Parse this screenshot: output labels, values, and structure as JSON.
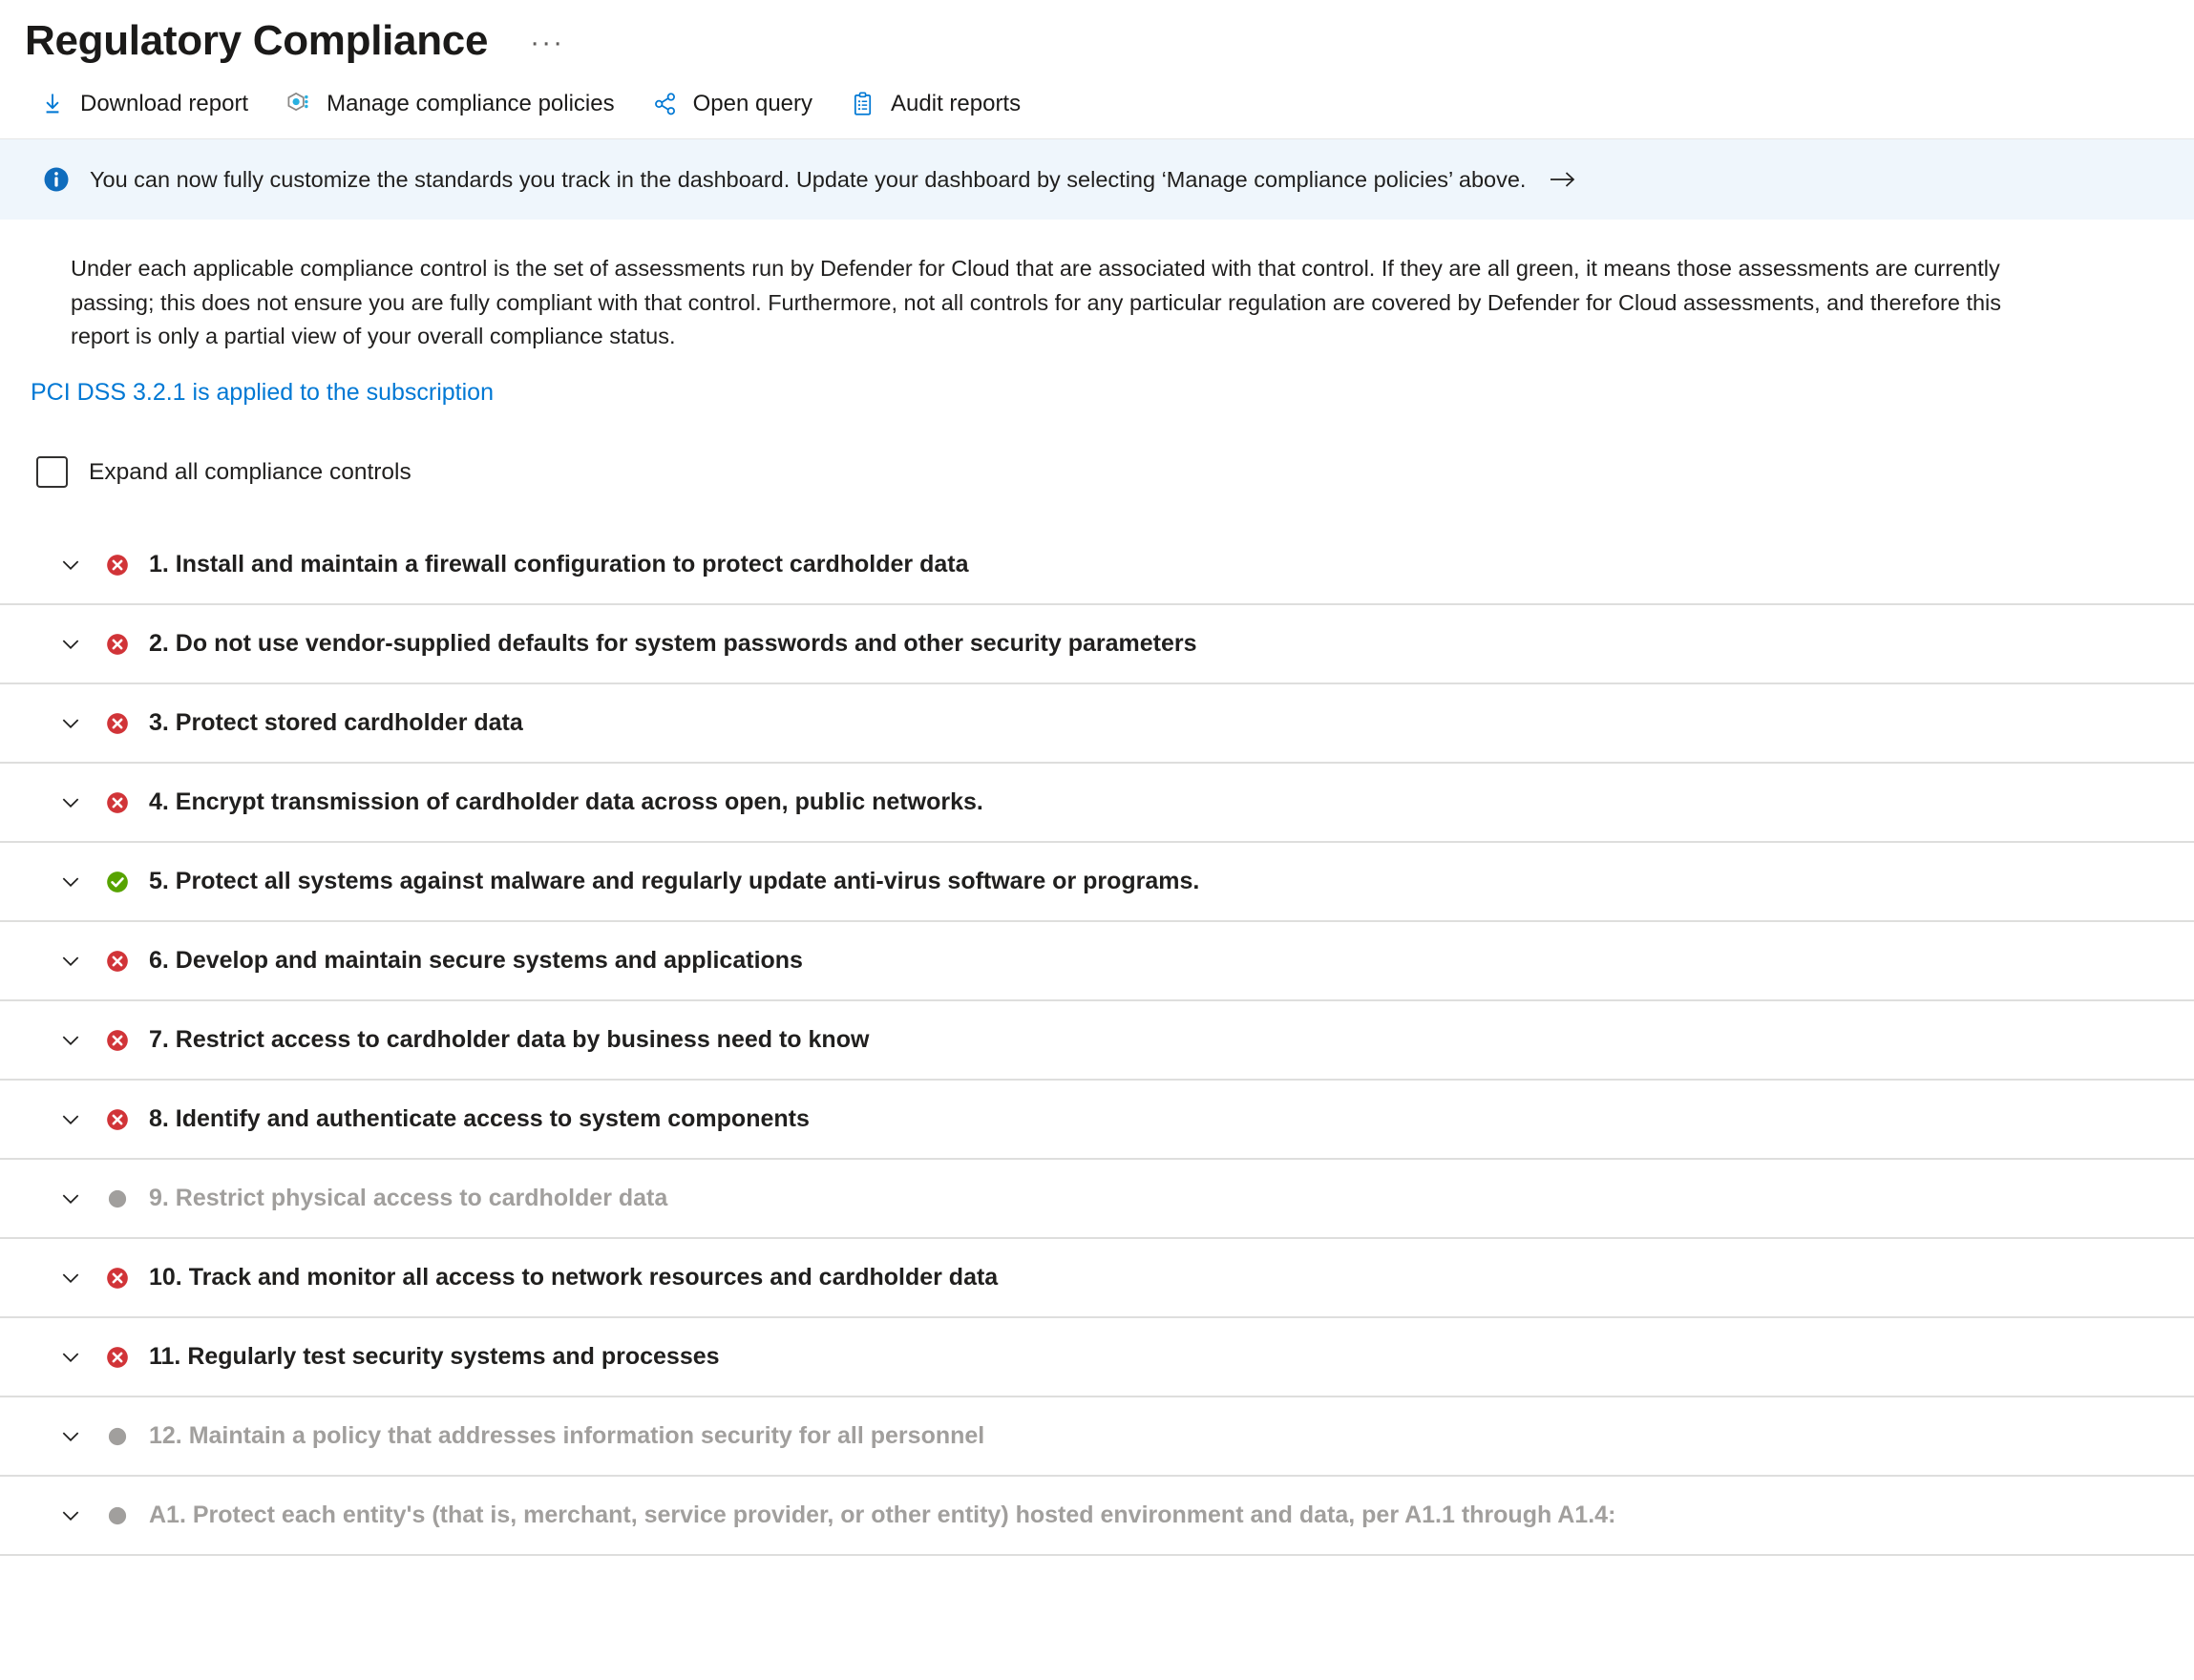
{
  "header": {
    "title": "Regulatory Compliance",
    "ellipsis": "···"
  },
  "toolbar": {
    "items": [
      {
        "label": "Download report",
        "icon": "download-icon"
      },
      {
        "label": "Manage compliance policies",
        "icon": "policy-hexagon-icon"
      },
      {
        "label": "Open query",
        "icon": "share-graph-icon"
      },
      {
        "label": "Audit reports",
        "icon": "clipboard-list-icon"
      }
    ]
  },
  "banner": {
    "icon": "info-circle-icon",
    "text": "You can now fully customize the standards you track in the dashboard. Update your dashboard by selecting ‘Manage compliance policies’ above.",
    "arrow_icon": "arrow-right-icon"
  },
  "description": {
    "text": "Under each applicable compliance control is the set of assessments run by Defender for Cloud that are associated with that control. If they are all green, it means those assessments are currently passing; this does not ensure you are fully compliant with that control. Furthermore, not all controls for any particular regulation are covered by Defender for Cloud assessments, and therefore this report is only a partial view of your overall compliance status."
  },
  "subscription": {
    "link_text": "PCI DSS 3.2.1 is applied to the subscription"
  },
  "expand_all": {
    "label": "Expand all compliance controls",
    "checked": false
  },
  "colors": {
    "accent": "#0078d4",
    "failed": "#d13438",
    "passed": "#57a300",
    "not_assessed": "#a19f9d",
    "banner_bg": "#eff6fc",
    "divider": "#dededd"
  },
  "controls": [
    {
      "label": "1. Install and maintain a firewall configuration to protect cardholder data",
      "status": "failed"
    },
    {
      "label": "2. Do not use vendor-supplied defaults for system passwords and other security parameters",
      "status": "failed"
    },
    {
      "label": "3. Protect stored cardholder data",
      "status": "failed"
    },
    {
      "label": "4. Encrypt transmission of cardholder data across open, public networks.",
      "status": "failed"
    },
    {
      "label": "5. Protect all systems against malware and regularly update anti-virus software or programs.",
      "status": "passed"
    },
    {
      "label": "6. Develop and maintain secure systems and applications",
      "status": "failed"
    },
    {
      "label": "7. Restrict access to cardholder data by business need to know",
      "status": "failed"
    },
    {
      "label": "8. Identify and authenticate access to system components",
      "status": "failed"
    },
    {
      "label": "9. Restrict physical access to cardholder data",
      "status": "not_assessed"
    },
    {
      "label": "10. Track and monitor all access to network resources and cardholder data",
      "status": "failed"
    },
    {
      "label": "11. Regularly test security systems and processes",
      "status": "failed"
    },
    {
      "label": "12. Maintain a policy that addresses information security for all personnel",
      "status": "not_assessed"
    },
    {
      "label": "A1. Protect each entity's (that is, merchant, service provider, or other entity) hosted environment and data, per A1.1 through A1.4:",
      "status": "not_assessed"
    }
  ]
}
